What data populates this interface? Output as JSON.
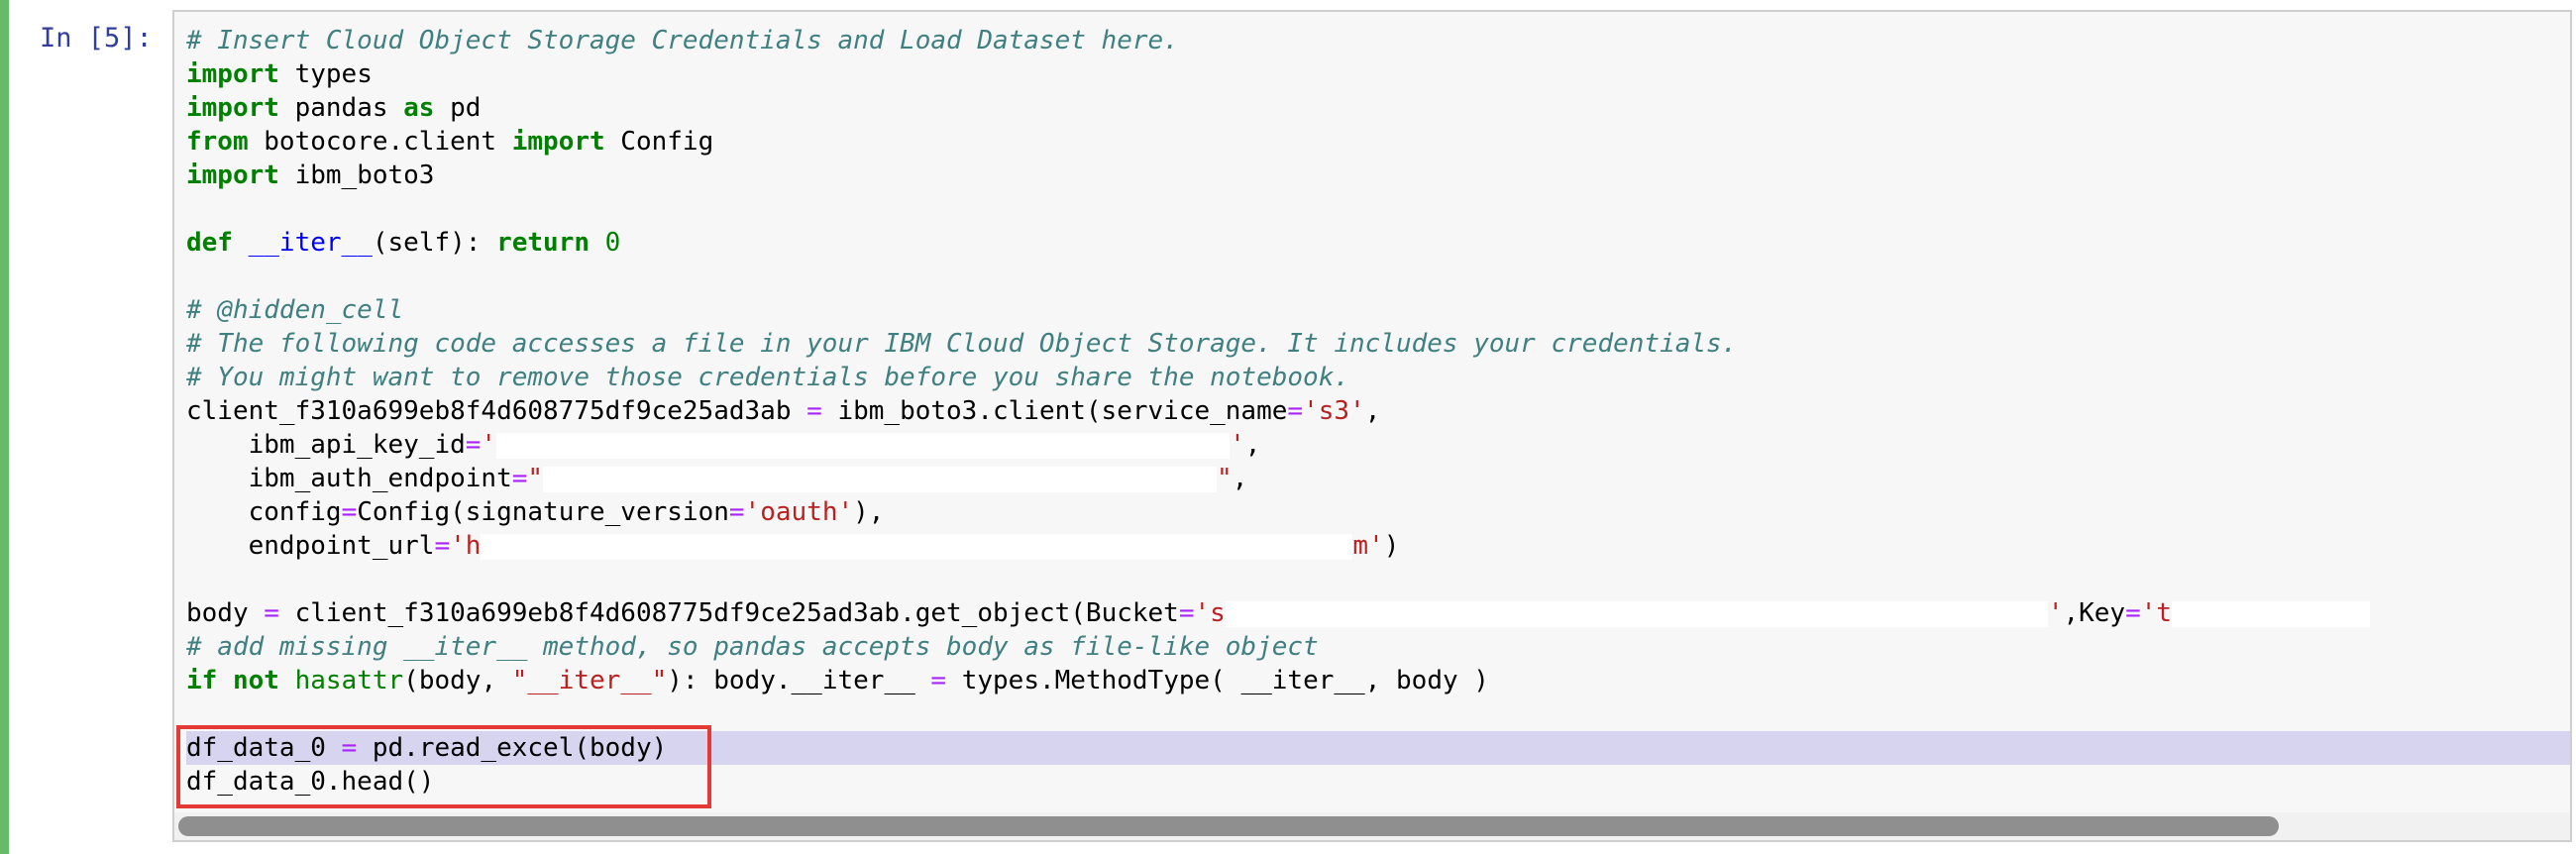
{
  "cell": {
    "prompt": "In [5]:",
    "lines": {
      "l1": "# Insert Cloud Object Storage Credentials and Load Dataset here.",
      "l2_kw": "import",
      "l2_rest": " types",
      "l3_kw": "import",
      "l3_mid": " pandas ",
      "l3_as": "as",
      "l3_rest": " pd",
      "l4_kw": "from",
      "l4_mid": " botocore.client ",
      "l4_imp": "import",
      "l4_rest": " Config",
      "l5_kw": "import",
      "l5_rest": " ibm_boto3",
      "l7_def": "def",
      "l7_name": "__iter__",
      "l7_args": "(self): ",
      "l7_ret": "return",
      "l7_zero": "0",
      "l9": "# @hidden_cell",
      "l10": "# The following code accesses a file in your IBM Cloud Object Storage. It includes your credentials.",
      "l11": "# You might want to remove those credentials before you share the notebook.",
      "l12_a": "client_f310a699eb8f4d608775df9ce25ad3ab ",
      "l12_eq": "=",
      "l12_b": " ibm_boto3.client(service_name",
      "l12_eq2": "=",
      "l12_s": "'s3'",
      "l12_end": ",",
      "l13_a": "    ibm_api_key_id",
      "l13_eq": "=",
      "l13_s1": "'",
      "l13_s2": "'",
      "l13_end": ",",
      "l14_a": "    ibm_auth_endpoint",
      "l14_eq": "=",
      "l14_s1": "\"",
      "l14_s2": "\"",
      "l14_end": ",",
      "l15_a": "    config",
      "l15_eq": "=",
      "l15_b": "Config(signature_version",
      "l15_eq2": "=",
      "l15_s": "'oauth'",
      "l15_end": "),",
      "l16_a": "    endpoint_url",
      "l16_eq": "=",
      "l16_s1": "'h",
      "l16_s2": "m'",
      "l16_end": ")",
      "l18_a": "body ",
      "l18_eq": "=",
      "l18_b": " client_f310a699eb8f4d608775df9ce25ad3ab.get_object(Bucket",
      "l18_eq2": "=",
      "l18_s1": "'s",
      "l18_s2": "'",
      "l18_key": ",Key",
      "l18_eq3": "=",
      "l18_s3": "'t",
      "l19": "# add missing __iter__ method, so pandas accepts body as file-like object",
      "l20_if": "if",
      "l20_not": "not",
      "l20_fn": "hasattr",
      "l20_a": "(body, ",
      "l20_s": "\"__iter__\"",
      "l20_b": "): body.__iter__ ",
      "l20_eq": "=",
      "l20_c": " types.MethodType( __iter__, body )",
      "l22_a": "df_data_0 ",
      "l22_eq": "=",
      "l22_b": " pd.read_excel(body)",
      "l23": "df_data_0.head()"
    }
  }
}
